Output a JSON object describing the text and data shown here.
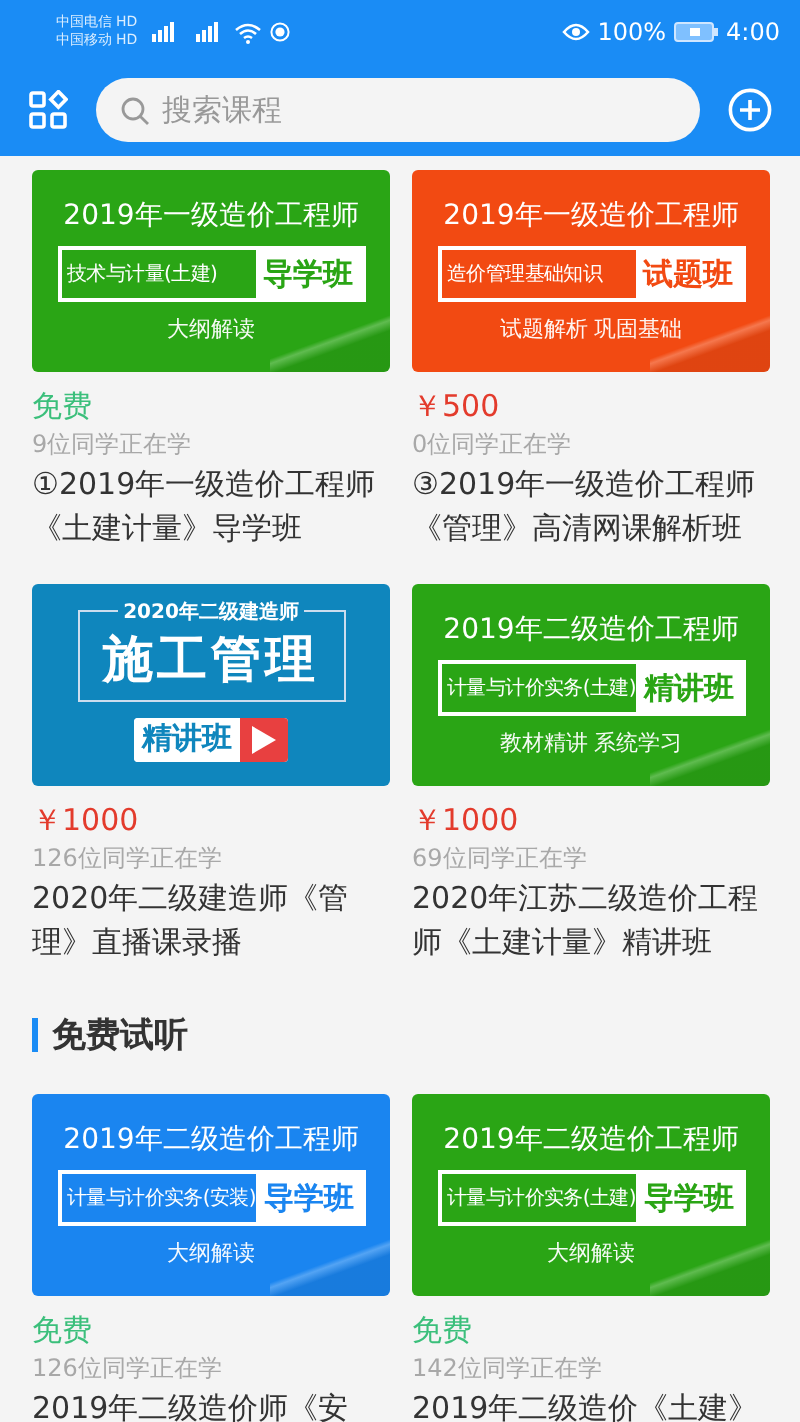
{
  "status_bar": {
    "carriers": [
      {
        "name": "中国电信",
        "badge": "HD"
      },
      {
        "name": "中国移动",
        "badge": "HD"
      }
    ],
    "battery": "100%",
    "time": "4:00"
  },
  "header": {
    "search": {
      "placeholder": "搜索课程"
    }
  },
  "courses": [
    {
      "banner": {
        "kind": "framed",
        "color": "#2aa515",
        "title": "2019年一级造价工程师",
        "subject": "技术与计量(土建)",
        "badge": "导学班",
        "tagline": "大纲解读"
      },
      "price": {
        "kind": "free",
        "text": "免费"
      },
      "learners": "9位同学正在学",
      "title": "①2019年一级造价工程师《土建计量》导学班"
    },
    {
      "banner": {
        "kind": "framed",
        "color": "#f24a12",
        "title": "2019年一级造价工程师",
        "subject": "造价管理基础知识",
        "badge": "试题班",
        "tagline": "试题解析  巩固基础"
      },
      "price": {
        "kind": "paid",
        "text": "￥500"
      },
      "learners": "0位同学正在学",
      "title": "③2019年一级造价工程师《管理》高清网课解析班"
    },
    {
      "banner": {
        "kind": "boxed",
        "color": "#0f86bd",
        "title": "2020年二级建造师",
        "subject": "施工管理",
        "badge": "精讲班"
      },
      "price": {
        "kind": "paid",
        "text": "￥1000"
      },
      "learners": "126位同学正在学",
      "title": "2020年二级建造师《管理》直播课录播"
    },
    {
      "banner": {
        "kind": "framed",
        "color": "#2aa515",
        "title": "2019年二级造价工程师",
        "subject": "计量与计价实务(土建)",
        "badge": "精讲班",
        "tagline": "教材精讲  系统学习"
      },
      "price": {
        "kind": "paid",
        "text": "￥1000"
      },
      "learners": "69位同学正在学",
      "title": "2020年江苏二级造价工程师《土建计量》精讲班"
    }
  ],
  "section": {
    "title": "免费试听"
  },
  "trial_courses": [
    {
      "banner": {
        "kind": "framed",
        "color": "#1a85f0",
        "title": "2019年二级造价工程师",
        "subject": "计量与计价实务(安装)",
        "badge": "导学班",
        "tagline": "大纲解读"
      },
      "price": {
        "kind": "free",
        "text": "免费"
      },
      "learners": "126位同学正在学",
      "title": "2019年二级造价师《安"
    },
    {
      "banner": {
        "kind": "framed",
        "color": "#2aa515",
        "title": "2019年二级造价工程师",
        "subject": "计量与计价实务(土建)",
        "badge": "导学班",
        "tagline": "大纲解读"
      },
      "price": {
        "kind": "free",
        "text": "免费"
      },
      "learners": "142位同学正在学",
      "title": "2019年二级造价《土建》"
    }
  ]
}
